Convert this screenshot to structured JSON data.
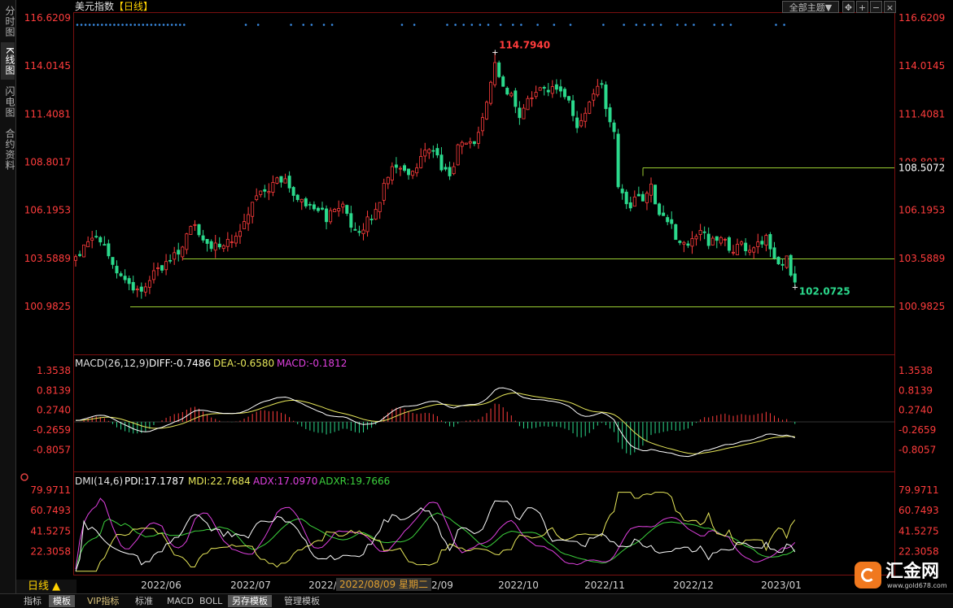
{
  "sidebar": {
    "tabs": [
      "分时图",
      "K线图",
      "闪电图",
      "合约资料"
    ],
    "active": 1
  },
  "header": {
    "symbol": "美元指数",
    "period_tag": "【日线】",
    "theme_button": "全部主题▼"
  },
  "colors": {
    "up": "#ff3c3c",
    "down": "#2bd98c",
    "diff": "#ffffff",
    "dea": "#e8e85a",
    "macd": "#e040e0",
    "pdi": "#ffffff",
    "mdi": "#e8e85a",
    "adx": "#e040e0",
    "adxr": "#3cd23c",
    "support": "#9acd32",
    "price_axis": "#ff3c3c"
  },
  "chart_data": [
    {
      "type": "candlestick",
      "title": "美元指数【日线】",
      "y_ticks": [
        "116.6209",
        "114.0145",
        "111.4081",
        "108.8017",
        "106.1953",
        "103.5889",
        "100.9825"
      ],
      "ylim": [
        100.9825,
        116.6209
      ],
      "high_label": "114.7940",
      "low_label": "102.0725",
      "level_lines": [
        {
          "value": 108.5072,
          "label": "108.5072"
        },
        {
          "value": 103.5889,
          "label": ""
        },
        {
          "value": 101.0,
          "label": ""
        }
      ],
      "x_ticks": [
        "2022/06",
        "2022/07",
        "2022/08",
        "2022/09",
        "2022/10",
        "2022/11",
        "2022/12",
        "2023/01"
      ],
      "cursor_date": "2022/08/09 星期二",
      "anchors": [
        [
          0,
          103.7
        ],
        [
          4,
          104.7
        ],
        [
          7,
          104.3
        ],
        [
          10,
          103.0
        ],
        [
          13,
          102.2
        ],
        [
          16,
          101.6
        ],
        [
          19,
          102.7
        ],
        [
          22,
          103.4
        ],
        [
          25,
          103.9
        ],
        [
          27,
          105.0
        ],
        [
          29,
          105.3
        ],
        [
          31,
          104.6
        ],
        [
          34,
          104.2
        ],
        [
          37,
          104.5
        ],
        [
          40,
          105.1
        ],
        [
          42,
          106.1
        ],
        [
          44,
          107.2
        ],
        [
          46,
          107.0
        ],
        [
          49,
          108.0
        ],
        [
          51,
          107.8
        ],
        [
          53,
          106.8
        ],
        [
          56,
          106.6
        ],
        [
          59,
          106.4
        ],
        [
          61,
          105.6
        ],
        [
          63,
          106.3
        ],
        [
          65,
          106.5
        ],
        [
          67,
          105.5
        ],
        [
          69,
          105.0
        ],
        [
          71,
          105.6
        ],
        [
          73,
          106.2
        ],
        [
          75,
          107.5
        ],
        [
          77,
          108.5
        ],
        [
          79,
          108.3
        ],
        [
          81,
          108.2
        ],
        [
          83,
          108.7
        ],
        [
          85,
          109.5
        ],
        [
          87,
          109.3
        ],
        [
          89,
          108.6
        ],
        [
          91,
          108.0
        ],
        [
          93,
          109.6
        ],
        [
          95,
          109.7
        ],
        [
          97,
          109.9
        ],
        [
          99,
          111.3
        ],
        [
          101,
          113.0
        ],
        [
          102,
          114.3
        ],
        [
          104,
          113.0
        ],
        [
          106,
          112.4
        ],
        [
          108,
          111.2
        ],
        [
          110,
          112.1
        ],
        [
          112,
          112.6
        ],
        [
          114,
          113.0
        ],
        [
          116,
          112.7
        ],
        [
          118,
          112.5
        ],
        [
          120,
          112.0
        ],
        [
          122,
          110.8
        ],
        [
          124,
          111.6
        ],
        [
          126,
          112.4
        ],
        [
          128,
          113.2
        ],
        [
          129,
          111.5
        ],
        [
          131,
          110.5
        ],
        [
          132,
          107.7
        ],
        [
          134,
          106.4
        ],
        [
          136,
          106.7
        ],
        [
          138,
          106.9
        ],
        [
          140,
          107.4
        ],
        [
          142,
          106.0
        ],
        [
          144,
          105.7
        ],
        [
          146,
          104.8
        ],
        [
          148,
          104.4
        ],
        [
          150,
          104.6
        ],
        [
          152,
          105.0
        ],
        [
          154,
          104.5
        ],
        [
          156,
          104.7
        ],
        [
          158,
          104.4
        ],
        [
          160,
          104.1
        ],
        [
          162,
          104.4
        ],
        [
          164,
          103.9
        ],
        [
          166,
          104.4
        ],
        [
          168,
          104.7
        ],
        [
          170,
          103.8
        ],
        [
          171,
          103.3
        ],
        [
          173,
          103.5
        ],
        [
          175,
          102.1
        ]
      ]
    },
    {
      "type": "line+bar",
      "title": "MACD(26,12,9)",
      "legend": [
        {
          "name": "DIFF",
          "value": "-0.7486"
        },
        {
          "name": "DEA",
          "value": "-0.6580"
        },
        {
          "name": "MACD",
          "value": "-0.1812"
        }
      ],
      "y_ticks": [
        "1.3538",
        "0.8139",
        "0.2740",
        "-0.2659",
        "-0.8057"
      ],
      "ylim": [
        -1.35,
        1.3538
      ]
    },
    {
      "type": "line",
      "title": "DMI(14,6)",
      "legend": [
        {
          "name": "PDI",
          "value": "17.1787"
        },
        {
          "name": "MDI",
          "value": "22.7684"
        },
        {
          "name": "ADX",
          "value": "17.0970"
        },
        {
          "name": "ADXR",
          "value": "19.7666"
        }
      ],
      "y_ticks": [
        "79.9711",
        "60.7493",
        "41.5275",
        "22.3058"
      ],
      "ylim": [
        3.0,
        79.9711
      ]
    }
  ],
  "footer": {
    "period_button": "日线 ▲",
    "tabs": [
      "指标",
      "模板",
      "VIP指标",
      "标准",
      "MACD",
      "BOLL",
      "另存模板",
      "管理模板"
    ],
    "active_tabs": [
      1,
      6
    ],
    "vip_tab": 2
  },
  "logo": {
    "name": "汇金网",
    "url": "www.gold678.com"
  }
}
